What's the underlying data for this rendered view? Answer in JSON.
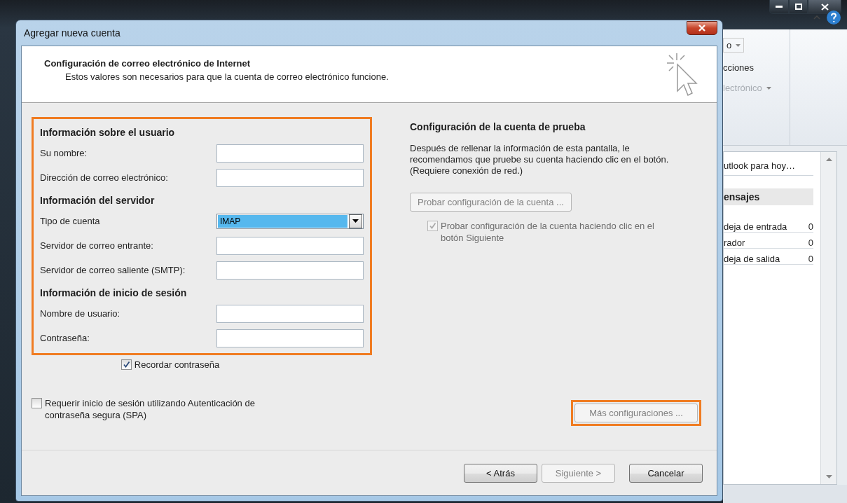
{
  "dialog": {
    "title": "Agregar nueva cuenta",
    "header": {
      "title": "Configuración de correo electrónico de Internet",
      "subtitle": "Estos valores son necesarios para que la cuenta de correo electrónico funcione."
    },
    "form_highlighted": true,
    "sections": [
      {
        "heading": "Información sobre el usuario",
        "fields": [
          {
            "label": "Su nombre:",
            "kind": "text"
          },
          {
            "label": "Dirección de correo electrónico:",
            "kind": "text"
          }
        ]
      },
      {
        "heading": "Información del servidor",
        "fields": [
          {
            "label": "Tipo de cuenta",
            "kind": "select",
            "value": "IMAP"
          },
          {
            "label": "Servidor de correo entrante:",
            "kind": "text"
          },
          {
            "label": "Servidor de correo saliente (SMTP):",
            "kind": "text"
          }
        ]
      },
      {
        "heading": "Información de inicio de sesión",
        "fields": [
          {
            "label": "Nombre de usuario:",
            "kind": "text"
          },
          {
            "label": "Contraseña:",
            "kind": "text"
          }
        ]
      }
    ],
    "remember_password": {
      "label": "Recordar contraseña",
      "checked": true
    },
    "spa": {
      "label": "Requerir inicio de sesión utilizando Autenticación de contraseña segura (SPA)",
      "checked": false
    },
    "test": {
      "heading": "Configuración de la cuenta de prueba",
      "description": "Después de rellenar la información de esta pantalla, le recomendamos que pruebe su cuenta haciendo clic en el botón. (Requiere conexión de red.)",
      "button": {
        "label": "Probar configuración de la cuenta ...",
        "disabled": true
      },
      "auto_test": {
        "label": "Probar configuración de la cuenta haciendo clic en el botón Siguiente",
        "checked": true,
        "disabled": true
      }
    },
    "more_settings": {
      "label": "Más configuraciones ...",
      "disabled": true,
      "highlighted": true
    },
    "buttons": [
      {
        "label": "< Atrás",
        "disabled": false
      },
      {
        "label": "Siguiente >",
        "disabled": true
      },
      {
        "label": "Cancelar",
        "disabled": false
      }
    ]
  },
  "background_app": {
    "ribbon": [
      {
        "label": "o",
        "kind": "dropdown",
        "disabled": false
      },
      {
        "label": "cciones",
        "kind": "plain",
        "disabled": false
      },
      {
        "label": "lectrónico",
        "kind": "dropdown",
        "disabled": true
      }
    ],
    "today_link": "utlook para hoy…",
    "messages": {
      "heading": "ensajes",
      "rows": [
        {
          "name": "deja de entrada",
          "count": "0"
        },
        {
          "name": "rador",
          "count": "0"
        },
        {
          "name": "deja de salida",
          "count": "0"
        }
      ]
    }
  }
}
